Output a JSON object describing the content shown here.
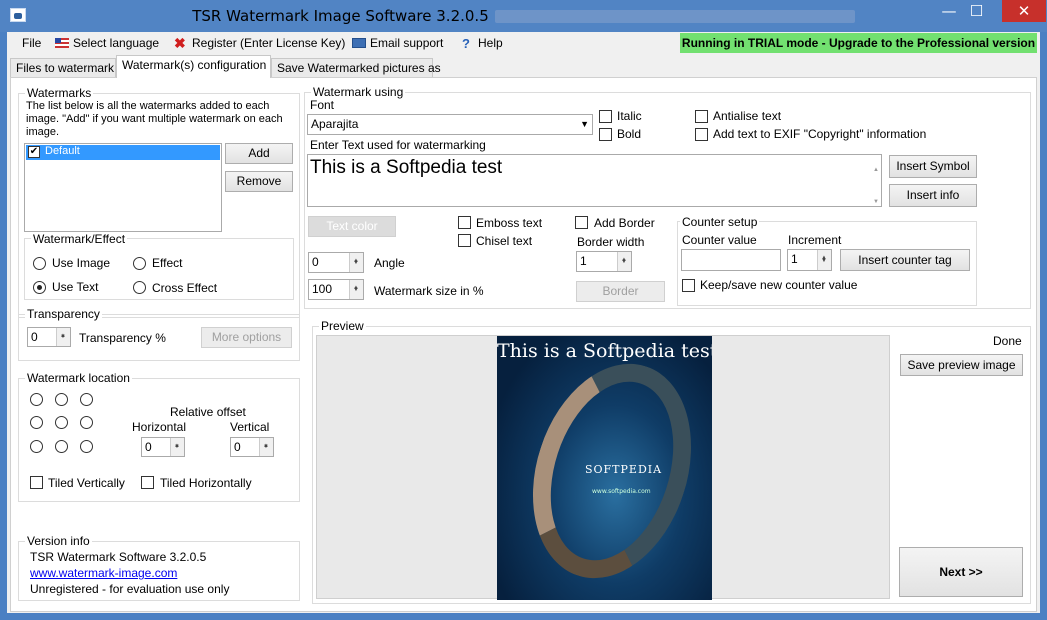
{
  "window": {
    "title": "TSR Watermark Image Software 3.2.0.5",
    "minimize_glyph": "—",
    "maximize_glyph": "☐",
    "close_glyph": "✕"
  },
  "menu": {
    "file": "File",
    "select_language": "Select language",
    "register": "Register (Enter License Key)",
    "email_support": "Email support",
    "help": "Help",
    "help_glyph": "?",
    "register_glyph": "✖"
  },
  "trial_banner": "Running in TRIAL mode - Upgrade to the Professional version",
  "tabs": [
    "Files to watermark",
    "Watermark(s) configuration",
    "Save Watermarked pictures as"
  ],
  "watermarks": {
    "group_label": "Watermarks",
    "description": "The list below is all the watermarks added to each image. \"Add\" if you want multiple watermark on each image.",
    "items": [
      {
        "label": "Default",
        "checked": true
      }
    ],
    "add": "Add",
    "remove": "Remove"
  },
  "watermark_effect": {
    "group_label": "Watermark/Effect",
    "use_image": "Use Image",
    "effect": "Effect",
    "use_text": "Use Text",
    "cross_effect": "Cross Effect",
    "selected": "Use Text"
  },
  "transparency": {
    "group_label": "Transparency",
    "value": "0",
    "label": "Transparency %",
    "more_options": "More options"
  },
  "location": {
    "group_label": "Watermark location",
    "relative_offset": "Relative offset",
    "horizontal": "Horizontal",
    "vertical": "Vertical",
    "horizontal_value": "0",
    "vertical_value": "0",
    "tiled_vertically": "Tiled Vertically",
    "tiled_horizontally": "Tiled Horizontally"
  },
  "version": {
    "group_label": "Version info",
    "name": "TSR Watermark Software 3.2.0.5",
    "url": "www.watermark-image.com",
    "status": "Unregistered - for evaluation use only"
  },
  "watermark_using": {
    "group_label": "Watermark using",
    "font_label": "Font",
    "font_value": "Aparajita",
    "italic": "Italic",
    "bold": "Bold",
    "antialise": "Antialise text",
    "exif": "Add text to EXIF \"Copyright\" information",
    "text_label": "Enter Text used for watermarking",
    "text_value": "This is a Softpedia test",
    "insert_symbol": "Insert Symbol",
    "insert_info": "Insert info",
    "text_color": "Text color",
    "emboss": "Emboss text",
    "chisel": "Chisel text",
    "add_border": "Add Border",
    "border_width_label": "Border width",
    "border_width_value": "1",
    "border": "Border",
    "angle_value": "0",
    "angle_label": "Angle",
    "size_value": "100",
    "size_label": "Watermark size in %"
  },
  "counter": {
    "group_label": "Counter setup",
    "value_label": "Counter value",
    "value": "",
    "increment_label": "Increment",
    "increment_value": "1",
    "insert_tag": "Insert counter tag",
    "keep": "Keep/save new counter value"
  },
  "preview": {
    "group_label": "Preview",
    "status": "Done",
    "save_preview": "Save preview image",
    "watermark_text": "This is a Softpedia test",
    "brand": "SOFTPEDIA",
    "brand_url": "www.softpedia.com"
  },
  "next": "Next >>"
}
